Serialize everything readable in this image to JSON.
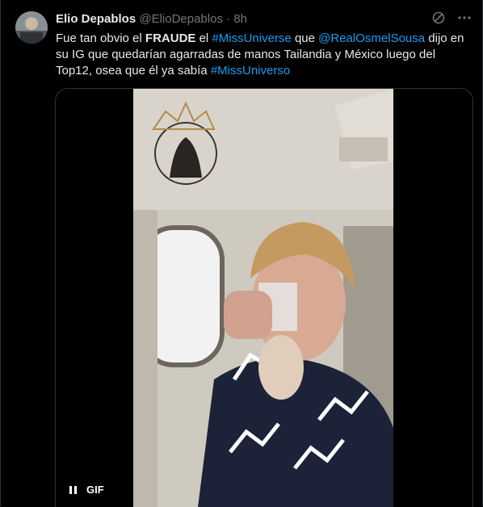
{
  "tweet": {
    "author_name": "Elio Depablos",
    "handle": "@ElioDepablos",
    "separator": "·",
    "time": "8h",
    "text": {
      "p1": "Fue tan obvio el ",
      "fraude": "FRAUDE",
      "p2": " el ",
      "hashtag1": "#MissUniverse",
      "p3": " que ",
      "mention": "@RealOsmelSousa",
      "p4": " dijo en su IG que quedarían agarradas de manos Tailandia y México luego del Top12, osea que él ya sabía ",
      "hashtag2": "#MissUniverso"
    }
  },
  "media": {
    "gif_label": "GIF"
  },
  "icons": {
    "header": [
      "grok-icon",
      "more-icon"
    ],
    "media_controls": [
      "pause-icon"
    ]
  },
  "colors": {
    "background": "#000000",
    "text": "#e7e9ea",
    "secondary": "#71767b",
    "link": "#1d9bf0"
  }
}
